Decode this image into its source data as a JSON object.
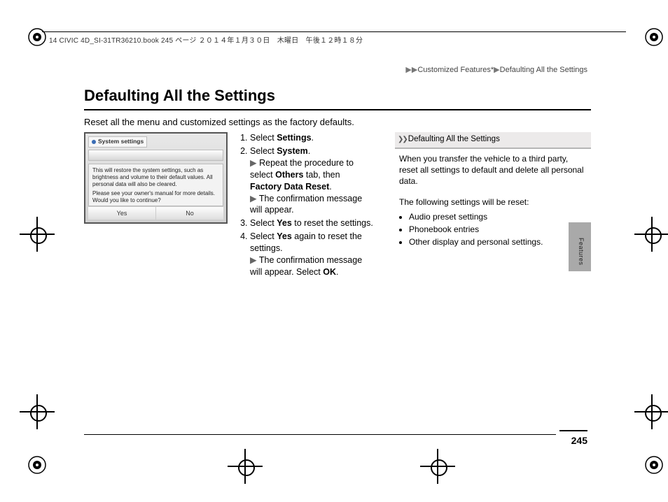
{
  "header": {
    "file_stamp": "14 CIVIC 4D_SI-31TR36210.book  245 ページ  ２０１４年１月３０日　木曜日　午後１２時１８分"
  },
  "breadcrumb": {
    "arrows": "▶▶",
    "level1": "Customized Features*",
    "sep": "▶",
    "level2": "Defaulting All the Settings"
  },
  "page": {
    "title": "Defaulting All the Settings",
    "intro": "Reset all the menu and customized settings as the factory defaults.",
    "number": "245"
  },
  "screenshot": {
    "tab": "System settings",
    "text1": "This will restore the system settings, such as brightness and volume to their default values. All personal data will also be cleared.",
    "text2": "Please see your owner's manual for more details. Would you like to continue?",
    "yes": "Yes",
    "no": "No"
  },
  "steps": {
    "s1_a": "Select ",
    "s1_b": "Settings",
    "s1_c": ".",
    "s2_a": "Select ",
    "s2_b": "System",
    "s2_c": ".",
    "s2_sub1_a": "Repeat the procedure to select ",
    "s2_sub1_b": "Others",
    "s2_sub1_c": " tab, then ",
    "s2_sub1_d": "Factory Data Reset",
    "s2_sub1_e": ".",
    "s2_sub2": "The confirmation message will appear.",
    "s3_a": "Select ",
    "s3_b": "Yes",
    "s3_c": " to reset the settings.",
    "s4_a": "Select ",
    "s4_b": "Yes",
    "s4_c": " again to reset the settings.",
    "s4_sub1": "The confirmation message will appear. Select ",
    "s4_sub1b": "OK",
    "s4_sub1c": "."
  },
  "right": {
    "heading": "Defaulting All the Settings",
    "p1": "When you transfer the vehicle to a third party, reset all settings to default and delete all personal data.",
    "p2": "The following settings will be reset:",
    "items": {
      "0": "Audio preset settings",
      "1": "Phonebook entries",
      "2": "Other display and personal settings."
    }
  },
  "side_label": "Features",
  "arrow_glyph": "▶"
}
